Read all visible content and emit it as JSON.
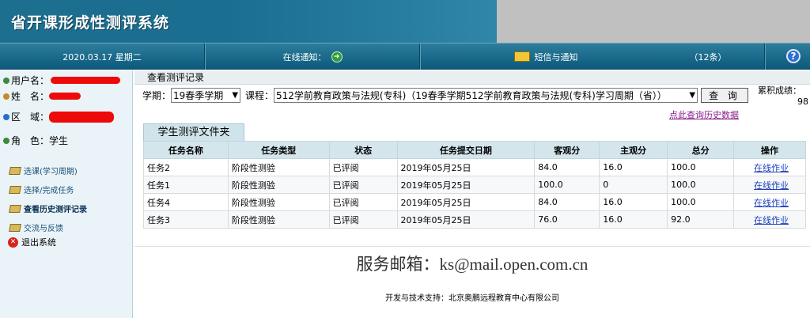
{
  "header": {
    "title": "省开课形成性测评系统"
  },
  "navbar": {
    "date": "2020.03.17 星期二",
    "online_notice": "在线通知：",
    "sms_notice": "短信与通知",
    "count": "（12条）"
  },
  "sidebar": {
    "fields": [
      {
        "label": "用户名：",
        "value": ""
      },
      {
        "label": "姓　名：",
        "value": ""
      },
      {
        "label": "区　域：",
        "value": ""
      },
      {
        "label": "角　色：",
        "value": "学生"
      }
    ],
    "links": [
      "选课(学习周期)",
      "选择/完成任务",
      "查看历史测评记录",
      "交流与反馈",
      "退出系统"
    ]
  },
  "main": {
    "title": "查看测评记录",
    "semester_label": "学期：",
    "semester_value": "19春季学期",
    "course_label": "课程：",
    "course_value": "512学前教育政策与法规(专科)（19春季学期512学前教育政策与法规(专科)学习周期（省））",
    "search_button": "查 询",
    "score_label": "累积成绩：",
    "score_value": "98",
    "history_link": "点此查询历史数据",
    "folder_tab": "学生测评文件夹"
  },
  "table": {
    "headers": [
      "任务名称",
      "任务类型",
      "状态",
      "任务提交日期",
      "客观分",
      "主观分",
      "总分",
      "操作"
    ],
    "rows": [
      [
        "任务2",
        "阶段性测验",
        "已评阅",
        "2019年05月25日",
        "84.0",
        "16.0",
        "100.0",
        "在线作业"
      ],
      [
        "任务1",
        "阶段性测验",
        "已评阅",
        "2019年05月25日",
        "100.0",
        "0",
        "100.0",
        "在线作业"
      ],
      [
        "任务4",
        "阶段性测验",
        "已评阅",
        "2019年05月25日",
        "84.0",
        "16.0",
        "100.0",
        "在线作业"
      ],
      [
        "任务3",
        "阶段性测验",
        "已评阅",
        "2019年05月25日",
        "76.0",
        "16.0",
        "92.0",
        "在线作业"
      ]
    ]
  },
  "footer": {
    "email": "服务邮箱：ks@mail.open.com.cn",
    "support": "开发与技术支持：北京奥鹏远程教育中心有限公司"
  },
  "colors": {
    "banner": "#1a6e90",
    "navbar": "#0d5a7c",
    "redaction": "#ee0a0a",
    "link": "#1a3fbf"
  }
}
